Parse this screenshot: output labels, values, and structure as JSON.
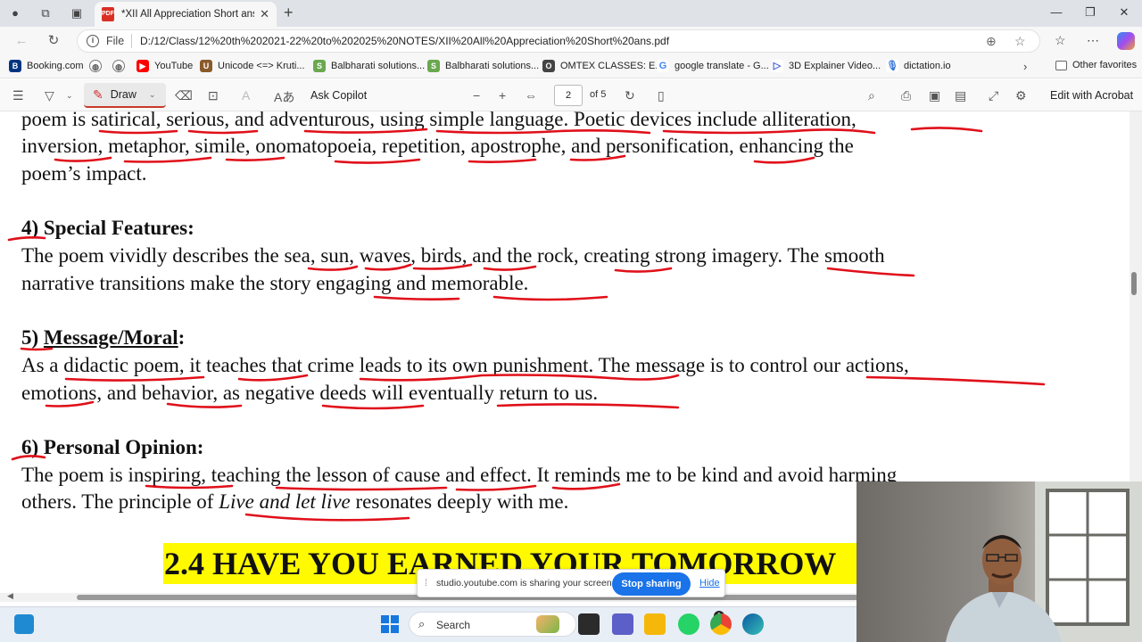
{
  "browser": {
    "tab_title": "*XII All Appreciation Short ans.pd",
    "url_scheme_label": "File",
    "url": "D:/12/Class/12%20th%202021-22%20to%202025%20NOTES/XII%20All%20Appreciation%20Short%20ans.pdf",
    "window_controls": [
      "—",
      "❐",
      "✕"
    ]
  },
  "favorites": [
    {
      "label": "Booking.com",
      "icon": "booking-icon",
      "color": "#003580"
    },
    {
      "label": "",
      "icon": "globe-icon",
      "color": "#666666"
    },
    {
      "label": "YouTube",
      "icon": "youtube-icon",
      "color": "#ff0000"
    },
    {
      "label": "Unicode <=> Kruti...",
      "icon": "unicode-icon",
      "color": "#8a5a2b"
    },
    {
      "label": "Balbharati solutions...",
      "icon": "shaalaa-icon",
      "color": "#6aa84f"
    },
    {
      "label": "Balbharati solutions...",
      "icon": "shaalaa-icon",
      "color": "#6aa84f"
    },
    {
      "label": "OMTEX CLASSES: E...",
      "icon": "omtex-icon",
      "color": "#444444"
    },
    {
      "label": "google translate - G...",
      "icon": "google-icon",
      "color": "#4285f4"
    },
    {
      "label": "3D Explainer Video...",
      "icon": "play-icon",
      "color": "#3b5bdb"
    },
    {
      "label": "dictation.io",
      "icon": "mic-icon",
      "color": "#3c78d8"
    }
  ],
  "favorites_other": "Other favorites",
  "pdf_toolbar": {
    "draw_label": "Draw",
    "ask_label": "Ask Copilot",
    "page_current": "2",
    "page_total": "of 5",
    "edit_label": "Edit with Acrobat"
  },
  "document": {
    "lines": [
      "poem is satirical, serious, and adventurous, using simple language. Poetic devices include alliteration,",
      "inversion, metaphor, simile, onomatopoeia, repetition, apostrophe, and personification, enhancing the",
      "poem’s impact."
    ],
    "sections": [
      {
        "heading": "4) Special Features:",
        "lines": [
          "The poem vividly describes the sea, sun, waves, birds, and the rock, creating strong imagery. The smooth",
          "narrative transitions make the story engaging and memorable."
        ]
      },
      {
        "heading_prefix": "5) ",
        "heading_main": "Message/Moral",
        "heading_suffix": ":",
        "lines": [
          "As a didactic poem, it teaches that crime leads to its own punishment. The message is to control our actions,",
          "emotions, and behavior, as negative deeds will eventually return to us."
        ]
      },
      {
        "heading": "6) Personal Opinion:",
        "line1": "The poem is inspiring, teaching the lesson of cause and effect. It reminds me to be kind and avoid harming",
        "line2_before": "others. The principle of ",
        "line2_italic": "Live and let live",
        "line2_after": " resonates deeply with me."
      }
    ],
    "banner": "2.4 HAVE YOU EARNED YOUR TOMORROW"
  },
  "share_notice": {
    "text": "studio.youtube.com is sharing your screen.",
    "stop_label": "Stop sharing",
    "hide_label": "Hide"
  },
  "taskbar": {
    "search_label": "Search",
    "badge_count": "1"
  }
}
